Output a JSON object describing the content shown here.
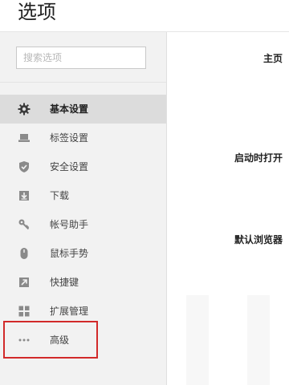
{
  "page": {
    "title": "选项"
  },
  "search": {
    "placeholder": "搜索选项",
    "value": ""
  },
  "sidebar": {
    "items": [
      {
        "label": "基本设置",
        "icon": "gear-icon",
        "active": true
      },
      {
        "label": "标签设置",
        "icon": "laptop-icon",
        "active": false
      },
      {
        "label": "安全设置",
        "icon": "shield-icon",
        "active": false
      },
      {
        "label": "下载",
        "icon": "download-icon",
        "active": false
      },
      {
        "label": "帐号助手",
        "icon": "key-icon",
        "active": false
      },
      {
        "label": "鼠标手势",
        "icon": "mouse-icon",
        "active": false
      },
      {
        "label": "快捷键",
        "icon": "shortcut-arrow-icon",
        "active": false
      },
      {
        "label": "扩展管理",
        "icon": "extensions-grid-icon",
        "active": false
      },
      {
        "label": "高级",
        "icon": "more-dots-icon",
        "active": false
      }
    ]
  },
  "main": {
    "settings": [
      {
        "label": "主页"
      },
      {
        "label": "启动时打开"
      },
      {
        "label": "默认浏览器"
      }
    ]
  },
  "colors": {
    "sidebar_bg": "#f2f2f2",
    "active_item_bg": "#dcdcdc",
    "highlight_border": "#d22a2a",
    "icon_color": "#8a8a8a"
  }
}
